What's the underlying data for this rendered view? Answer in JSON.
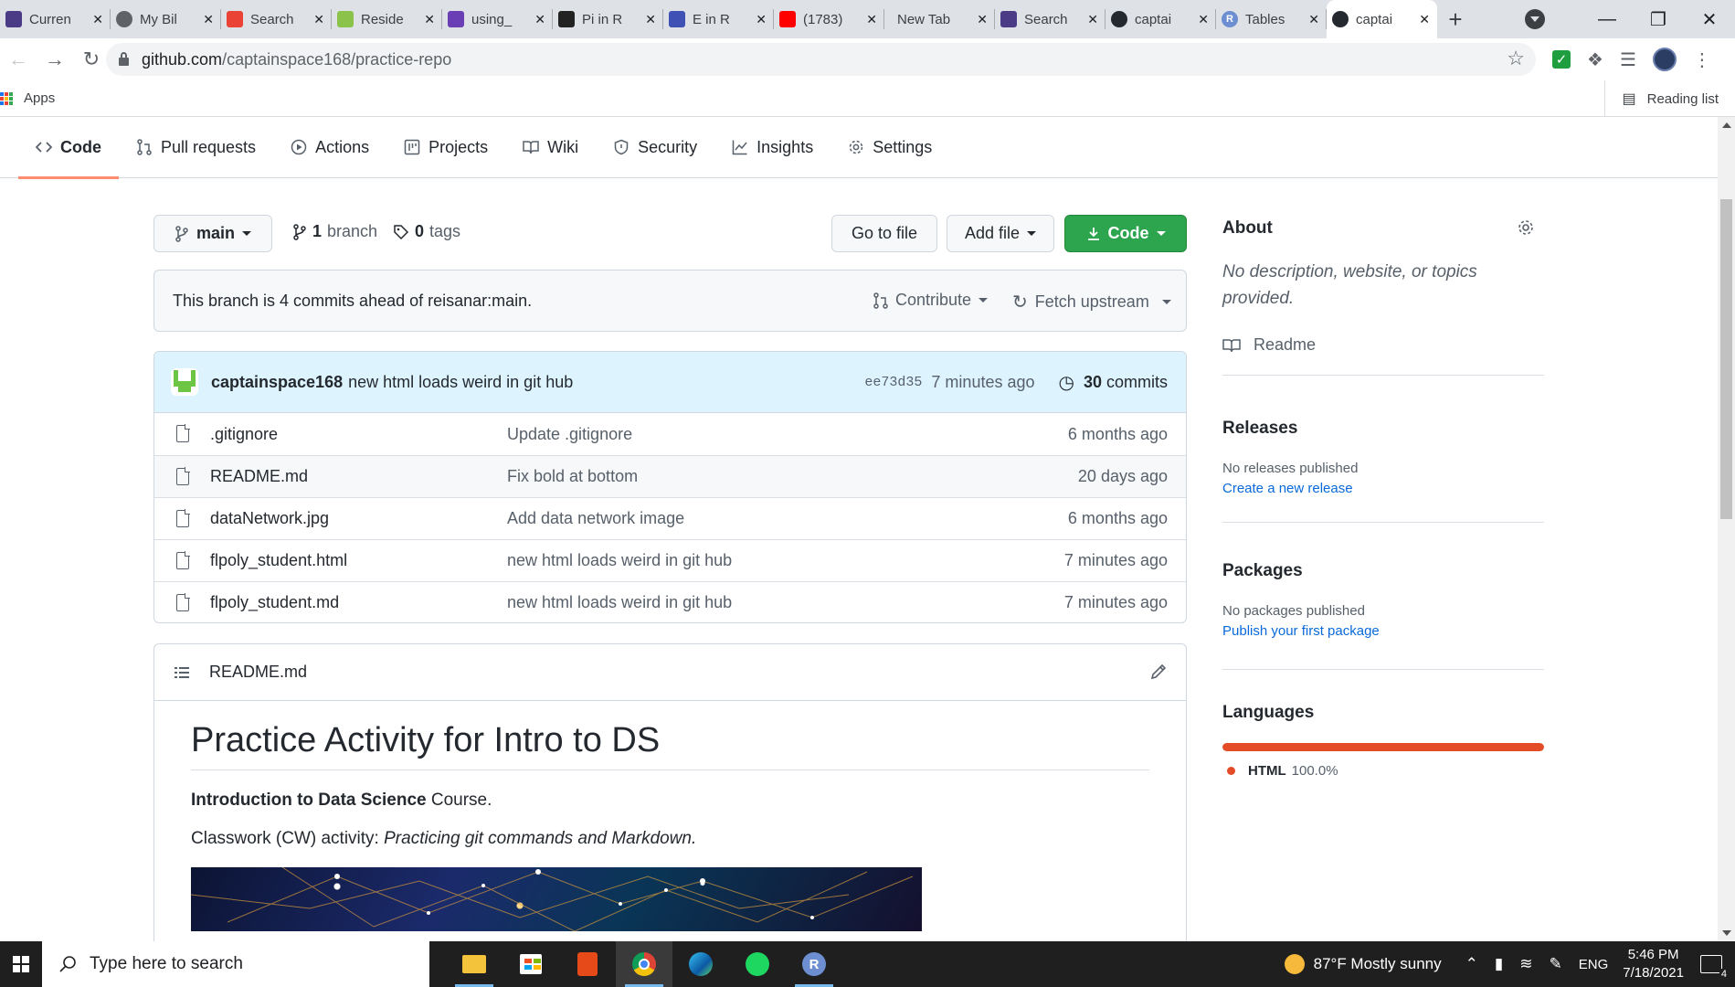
{
  "browser": {
    "tabs": [
      {
        "title": "Curren",
        "icon": "onenote-icon",
        "color": "#4b3a86"
      },
      {
        "title": "My Bil",
        "icon": "globe-icon",
        "color": "#5f6368"
      },
      {
        "title": "Search",
        "icon": "gmail-icon",
        "color": "#ea4335"
      },
      {
        "title": "Reside",
        "icon": "sheets-icon",
        "color": "#8bc34a"
      },
      {
        "title": "using_",
        "icon": "chat-icon",
        "color": "#6a3fb5"
      },
      {
        "title": "Pi in R",
        "icon": "video-icon",
        "color": "#222222"
      },
      {
        "title": "E in R",
        "icon": "gear-site-icon",
        "color": "#3f51b5"
      },
      {
        "title": "(1783)",
        "icon": "youtube-icon",
        "color": "#ff0000"
      },
      {
        "title": "New Tab",
        "icon": "none",
        "color": "#dee1e6"
      },
      {
        "title": "Search",
        "icon": "onenote-icon",
        "color": "#4b3a86"
      },
      {
        "title": "captai",
        "icon": "github-icon",
        "color": "#24292f"
      },
      {
        "title": "Tables",
        "icon": "r-icon",
        "color": "#6d8fd1"
      },
      {
        "title": "captai",
        "icon": "github-icon",
        "color": "#24292f",
        "active": true
      }
    ],
    "url_host": "github.com",
    "url_path": "/captainspace168/practice-repo",
    "bookmarks_apps": "Apps",
    "reading_list": "Reading list"
  },
  "repo_nav": {
    "tabs": [
      {
        "label": "Code",
        "icon": "code-icon"
      },
      {
        "label": "Pull requests",
        "icon": "pull-request-icon"
      },
      {
        "label": "Actions",
        "icon": "play-icon"
      },
      {
        "label": "Projects",
        "icon": "project-icon"
      },
      {
        "label": "Wiki",
        "icon": "book-icon"
      },
      {
        "label": "Security",
        "icon": "shield-icon"
      },
      {
        "label": "Insights",
        "icon": "graph-icon"
      },
      {
        "label": "Settings",
        "icon": "gear-icon"
      }
    ]
  },
  "branch_bar": {
    "branch": "main",
    "branch_count": "1",
    "branch_word": "branch",
    "tag_count": "0",
    "tag_word": "tags",
    "go_to_file": "Go to file",
    "add_file": "Add file",
    "code": "Code"
  },
  "ahead": {
    "message": "This branch is 4 commits ahead of reisanar:main.",
    "contribute": "Contribute",
    "fetch_upstream": "Fetch upstream"
  },
  "last_commit": {
    "author": "captainspace168",
    "message": "new html loads weird in git hub",
    "sha": "ee73d35",
    "age": "7 minutes ago",
    "commit_count": "30",
    "commit_word": "commits"
  },
  "files": [
    {
      "name": ".gitignore",
      "message": "Update .gitignore",
      "age": "6 months ago"
    },
    {
      "name": "README.md",
      "message": "Fix bold at bottom",
      "age": "20 days ago"
    },
    {
      "name": "dataNetwork.jpg",
      "message": "Add data network image",
      "age": "6 months ago"
    },
    {
      "name": "flpoly_student.html",
      "message": "new html loads weird in git hub",
      "age": "7 minutes ago"
    },
    {
      "name": "flpoly_student.md",
      "message": "new html loads weird in git hub",
      "age": "7 minutes ago"
    }
  ],
  "readme": {
    "filename": "README.md",
    "h1": "Practice Activity for Intro to DS",
    "p1_bold": "Introduction to Data Science",
    "p1_rest": " Course.",
    "p2_lead": "Classwork (CW) activity: ",
    "p2_italic": "Practicing git commands and Markdown."
  },
  "sidebar": {
    "about_title": "About",
    "about_desc": "No description, website, or topics provided.",
    "readme_link": "Readme",
    "releases_title": "Releases",
    "releases_none": "No releases published",
    "releases_link": "Create a new release",
    "packages_title": "Packages",
    "packages_none": "No packages published",
    "packages_link": "Publish your first package",
    "languages_title": "Languages",
    "language_name": "HTML",
    "language_pct": "100.0%",
    "language_color": "#e34c26",
    "language_fraction": 1.0
  },
  "taskbar": {
    "search_placeholder": "Type here to search",
    "weather": "87°F  Mostly sunny",
    "lang": "ENG",
    "time": "5:46 PM",
    "date": "7/18/2021",
    "notifications": "4"
  }
}
